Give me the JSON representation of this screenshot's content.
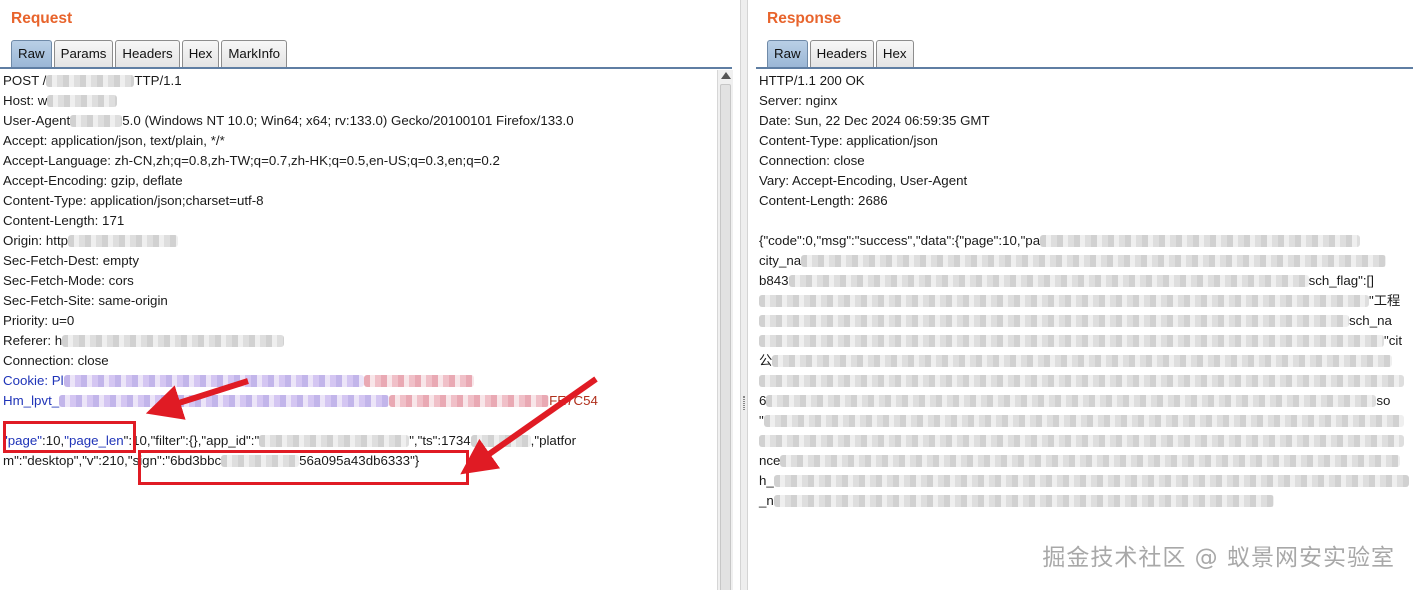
{
  "request": {
    "title": "Request",
    "tabs": [
      "Raw",
      "Params",
      "Headers",
      "Hex",
      "MarkInfo"
    ],
    "active_tab": "Raw",
    "lines": [
      {
        "pre": "POST /",
        "post": "TTP/1.1"
      },
      {
        "pre": "Host: w",
        "post": ""
      },
      {
        "pre": "User-Agent",
        "post": "5.0 (Windows NT 10.0; Win64; x64; rv:133.0) Gecko/20100101 Firefox/133.0"
      },
      {
        "pre": "Accept: application/json, text/plain, */*",
        "post": ""
      },
      {
        "pre": "Accept-Language: zh-CN,zh;q=0.8,zh-TW;q=0.7,zh-HK;q=0.5,en-US;q=0.3,en;q=0.2",
        "post": ""
      },
      {
        "pre": "Accept-Encoding: gzip, deflate",
        "post": ""
      },
      {
        "pre": "Content-Type: application/json;charset=utf-8",
        "post": ""
      },
      {
        "pre": "Content-Length: 171",
        "post": ""
      },
      {
        "pre": "Origin: http",
        "post": ""
      },
      {
        "pre": "Sec-Fetch-Dest: empty",
        "post": ""
      },
      {
        "pre": "Sec-Fetch-Mode: cors",
        "post": ""
      },
      {
        "pre": "Sec-Fetch-Site: same-origin",
        "post": ""
      },
      {
        "pre": "Priority: u=0",
        "post": ""
      },
      {
        "pre": "Referer: h",
        "post": ""
      },
      {
        "pre": "Connection: close",
        "post": ""
      },
      {
        "pre": "Cookie: Pl",
        "post": ""
      },
      {
        "pre": "Hm_lpvt_",
        "post": "FE7C54"
      }
    ],
    "body_line1": {
      "page_key": "\"page\"",
      "page_val": ":10,",
      "page_len_key": "\"page_len",
      "rest": "\":10,\"filter\":{},\"app_id\":\"",
      "ts": "\",\"ts\":1734",
      "tail": ",\"platfor"
    },
    "body_line2": {
      "pre": "m\":\"desktop\",\"v\":210,\"sign\":\"6bd3bbc",
      "sign_tail": "56a095a43db6333\"}"
    }
  },
  "response": {
    "title": "Response",
    "tabs": [
      "Raw",
      "Headers",
      "Hex"
    ],
    "active_tab": "Raw",
    "headers": [
      "HTTP/1.1 200 OK",
      "Server: nginx",
      "Date: Sun, 22 Dec 2024 06:59:35 GMT",
      "Content-Type: application/json",
      "Connection: close",
      "Vary: Accept-Encoding, User-Agent",
      "Content-Length: 2686"
    ],
    "body_start": "{\"code\":0,\"msg\":\"success\",\"data\":{\"page\":10,\"pa",
    "body_fragments": [
      "city_na",
      "b843",
      "sch_flag\":[]",
      "\"工程",
      "sch_na",
      "\"cit",
      "公",
      "so",
      "6",
      "\"",
      "nce",
      "h_",
      "_n"
    ]
  },
  "watermark": "掘金技术社区 @ 蚁景网安实验室",
  "colors": {
    "title": "#e8642c",
    "tab_active": "#a9c3e0",
    "highlight_box": "#e01b24",
    "cookie_text": "#1f34b8"
  }
}
